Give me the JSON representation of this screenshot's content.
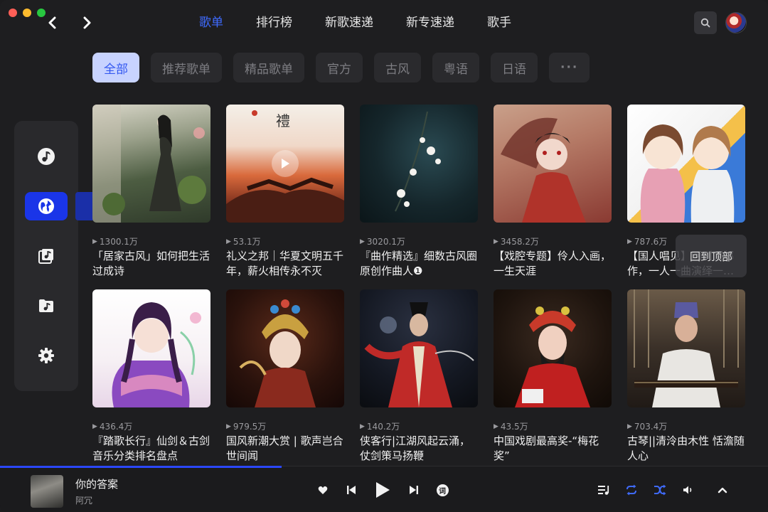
{
  "window": {
    "traffic_lights": [
      "close",
      "minimize",
      "maximize"
    ]
  },
  "nav": {
    "back_icon": "‹",
    "forward_icon": "›"
  },
  "tabs": [
    {
      "label": "歌单",
      "active": true
    },
    {
      "label": "排行榜"
    },
    {
      "label": "新歌速递"
    },
    {
      "label": "新专速递"
    },
    {
      "label": "歌手"
    }
  ],
  "filters": [
    {
      "label": "全部",
      "active": true
    },
    {
      "label": "推荐歌单"
    },
    {
      "label": "精品歌单"
    },
    {
      "label": "官方"
    },
    {
      "label": "古风"
    },
    {
      "label": "粤语"
    },
    {
      "label": "日语"
    },
    {
      "label": "···"
    }
  ],
  "sidebar": {
    "items": [
      "music-note-icon",
      "globe-icon",
      "music-library-icon",
      "music-folder-icon",
      "settings-gear-icon"
    ],
    "active_index": 1,
    "tooltip": "搜索"
  },
  "playlists": [
    {
      "plays": "1300.1万",
      "title": "「居家古风」如何把生活过成诗"
    },
    {
      "plays": "53.1万",
      "title": "礼义之邦｜华夏文明五千年，薪火相传永不灭"
    },
    {
      "plays": "3020.1万",
      "title": "『曲作精选』细数古风圈原创作曲人❶"
    },
    {
      "plays": "3458.2万",
      "title": "【戏腔专题】伶人入画，一生天涯"
    },
    {
      "plays": "787.6万",
      "title": "【国人唱见】回到顶部作，一人一曲演绎一…"
    },
    {
      "plays": "436.4万",
      "title": "『踏歌长行』仙剑＆古剑音乐分类排名盘点"
    },
    {
      "plays": "979.5万",
      "title": "国风新潮大赏 | 歌声岂合世间闻"
    },
    {
      "plays": "140.2万",
      "title": "侠客行|江湖风起云涌，仗剑策马扬鞭"
    },
    {
      "plays": "43.5万",
      "title": "中国戏剧最高奖-“梅花奖”"
    },
    {
      "plays": "703.4万",
      "title": "古琴||清泠由木性 恬澹随人心"
    }
  ],
  "back_to_top": "回到顶部",
  "player": {
    "song": "你的答案",
    "artist": "阿冗",
    "progress": 0.367,
    "lyric_button": "词",
    "accent": "#3f6bff"
  }
}
